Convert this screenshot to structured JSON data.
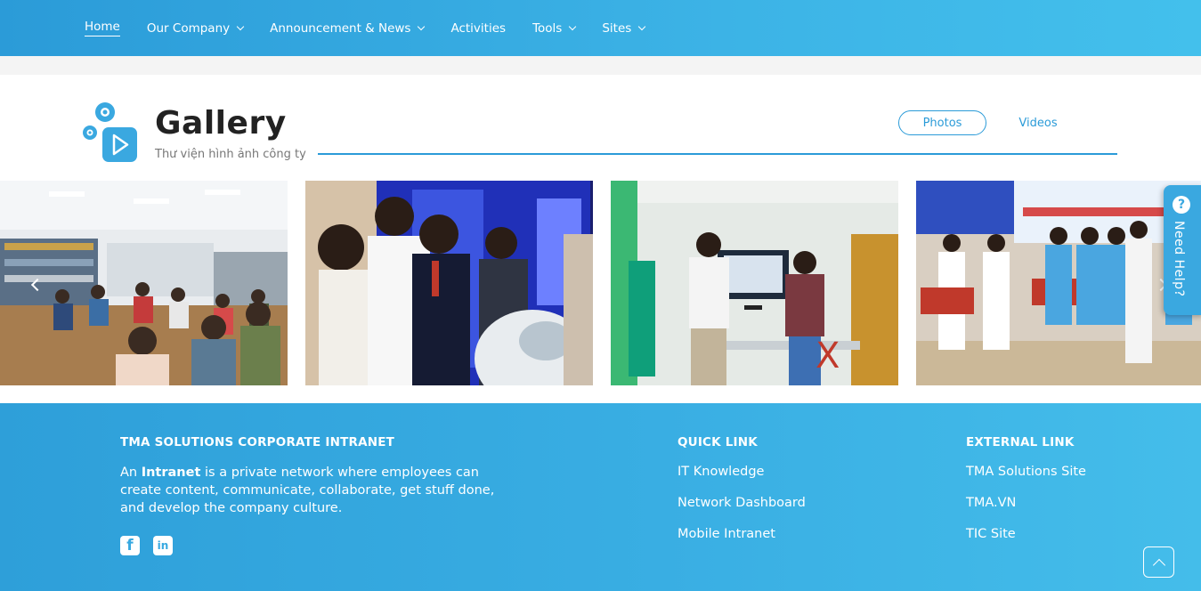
{
  "nav": {
    "items": [
      {
        "label": "Home",
        "active": true,
        "dropdown": false
      },
      {
        "label": "Our Company",
        "active": false,
        "dropdown": true
      },
      {
        "label": "Announcement & News",
        "active": false,
        "dropdown": true
      },
      {
        "label": "Activities",
        "active": false,
        "dropdown": false
      },
      {
        "label": "Tools",
        "active": false,
        "dropdown": true
      },
      {
        "label": "Sites",
        "active": false,
        "dropdown": true
      }
    ]
  },
  "gallery": {
    "title": "Gallery",
    "subtitle": "Thư viện hình ảnh công ty",
    "tabs": {
      "photos": "Photos",
      "videos": "Videos"
    },
    "photos": [
      {
        "icon": "photo-library-meeting"
      },
      {
        "icon": "photo-robot-exhibit"
      },
      {
        "icon": "photo-interview"
      },
      {
        "icon": "photo-football-team"
      }
    ]
  },
  "need_help": {
    "label": "Need Help?",
    "icon": "question-icon"
  },
  "footer": {
    "about_title": "TMA SOLUTIONS CORPORATE INTRANET",
    "about_prefix": "An ",
    "about_bold": "Intranet",
    "about_rest": " is a private network where employees can create content, communicate, collaborate, get stuff done, and develop the company culture.",
    "quick_link_title": "QUICK LINK",
    "quick_links": [
      "IT Knowledge",
      "Network Dashboard",
      "Mobile Intranet"
    ],
    "external_link_title": "EXTERNAL LINK",
    "external_links": [
      "TMA Solutions Site",
      "TMA.VN",
      "TIC Site"
    ],
    "social": {
      "facebook": "f",
      "linkedin": "in"
    }
  },
  "colors": {
    "brand": "#2b9bd8",
    "brand_light": "#43c0ec"
  }
}
